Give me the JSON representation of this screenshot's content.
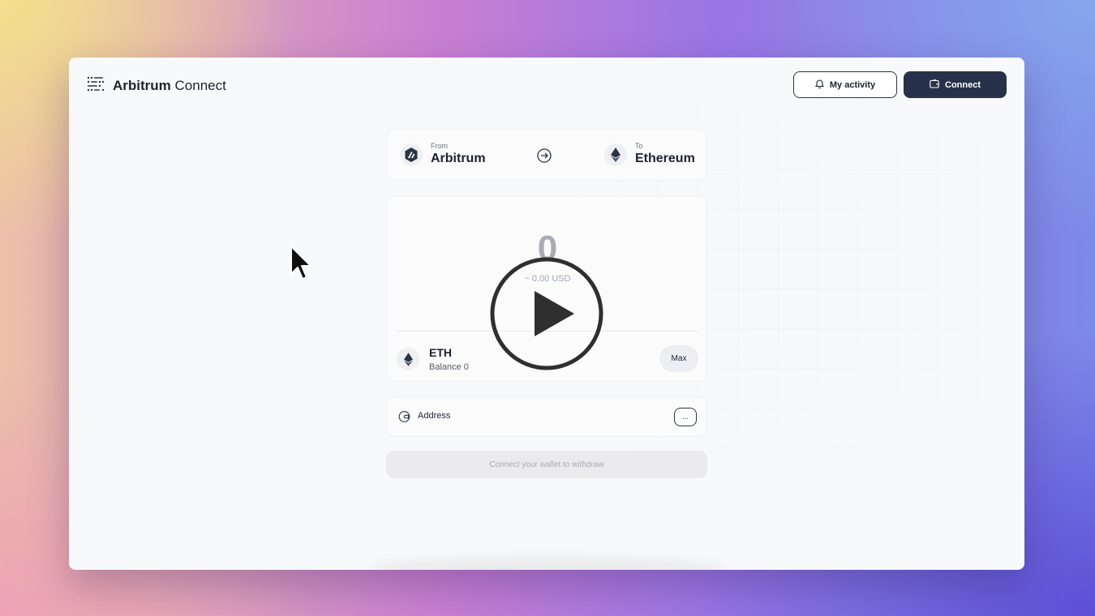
{
  "app": {
    "brand_bold": "Arbitrum",
    "brand_rest": " Connect",
    "logo_icon": "arbitrum-connect-logo"
  },
  "header": {
    "activity_label": "My activity",
    "activity_icon": "bell-icon",
    "connect_label": "Connect",
    "connect_icon": "wallet-icon"
  },
  "route": {
    "from_label": "From",
    "from_chain": "Arbitrum",
    "to_label": "To",
    "to_chain": "Ethereum"
  },
  "amount": {
    "value": "0",
    "usd": "~ 0.00 USD",
    "token_symbol": "ETH",
    "token_balance": "Balance 0",
    "max_label": "Max"
  },
  "address": {
    "label": "Address",
    "more_label": "..."
  },
  "withdraw": {
    "label": "Connect your wallet to withdraw"
  },
  "colors": {
    "primary_dark": "#27324a",
    "page_bg": "#f8f9fb",
    "muted_text": "#a8adb5"
  }
}
